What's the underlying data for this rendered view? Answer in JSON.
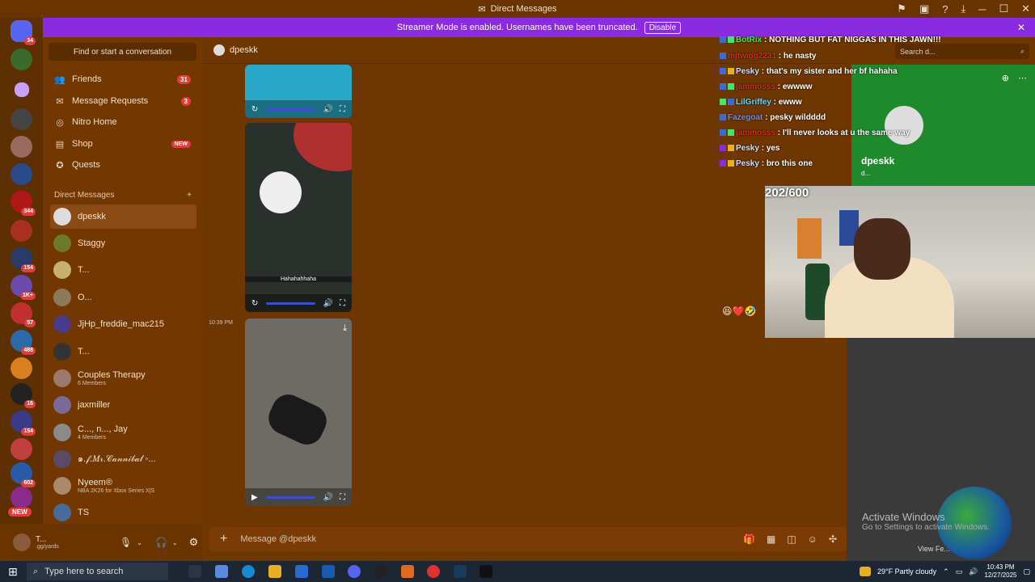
{
  "window": {
    "title": "Direct Messages"
  },
  "banner": {
    "text": "Streamer Mode is enabled. Usernames have been truncated.",
    "disable_label": "Disable"
  },
  "sidebar": {
    "search_label": "Find or start a conversation",
    "nav": [
      {
        "label": "Friends",
        "icon": "friends-icon",
        "count": "31"
      },
      {
        "label": "Message Requests",
        "icon": "mail-icon",
        "count": "3"
      },
      {
        "label": "Nitro Home",
        "icon": "nitro-icon"
      },
      {
        "label": "Shop",
        "icon": "shop-icon",
        "badge": "NEW"
      },
      {
        "label": "Quests",
        "icon": "quests-icon"
      }
    ],
    "dm_header": "Direct Messages",
    "dms": [
      {
        "name": "dpeskk"
      },
      {
        "name": "Staggy"
      },
      {
        "name": "T..."
      },
      {
        "name": "O..."
      },
      {
        "name": "JjHp_freddie_mac215"
      },
      {
        "name": "T..."
      },
      {
        "name": "Couples Therapy",
        "sub": "6 Members"
      },
      {
        "name": "jaxmiller"
      },
      {
        "name": "C..., n..., Jay",
        "sub": "4 Members"
      },
      {
        "name": "๑.𝒻.𝑀𝓇.𝒞𝒶𝓃𝓃𝒾𝒷𝒶𝓁 ◦..."
      },
      {
        "name": "Nyeem®",
        "sub": "NBA 2K26 for Xbox Series X|S"
      },
      {
        "name": "TS"
      }
    ]
  },
  "server_badges": [
    "34",
    "",
    "",
    "",
    "",
    "",
    "",
    "",
    "",
    "",
    "344",
    "154",
    "1K+",
    "",
    "57",
    "",
    "488",
    "",
    "",
    "16",
    "154",
    "",
    "602",
    "",
    "NEW"
  ],
  "user": {
    "name": "T...",
    "status": ".gg/yards"
  },
  "chat": {
    "recipient": "dpeskk",
    "timestamp": "10:39 PM",
    "caption": "Hahahahhaha",
    "placeholder": "Message @dpeskk"
  },
  "search": {
    "placeholder": "Search d..."
  },
  "overlay_chat": [
    {
      "user": "BotRix",
      "text": "NOTHING BUT FAT NIGGAS IN THIS JAWN!!!",
      "color": "#3ee86a"
    },
    {
      "user": "mjtwigg2231",
      "text": "he nasty",
      "color": "#d0301c"
    },
    {
      "user": "Pesky",
      "text": "that's my sister and her bf hahaha",
      "color": "#ffffff"
    },
    {
      "user": "jammosss",
      "text": "ewwww",
      "color": "#d0301c"
    },
    {
      "user": "LilGriffey",
      "text": "ewww",
      "color": "#5fd6ff"
    },
    {
      "user": "Fazegoat",
      "text": "pesky wildddd",
      "color": "#6a8cff"
    },
    {
      "user": "jammosss",
      "text": "I'll never looks at u the same way",
      "color": "#d0301c"
    },
    {
      "user": "Pesky",
      "text": "yes",
      "color": "#ffffff"
    },
    {
      "user": "Pesky",
      "text": "bro this one",
      "color": "#ffffff"
    }
  ],
  "profile": {
    "name": "dpeskk",
    "sub": "d..."
  },
  "stream": {
    "counter": "202/600"
  },
  "watermark": {
    "title": "Activate Windows",
    "sub": "Go to Settings to activate Windows.",
    "view": "View Fe..."
  },
  "taskbar": {
    "search_placeholder": "Type here to search",
    "weather": "29°F  Partly cloudy",
    "time": "10:43 PM",
    "date": "12/27/2025"
  }
}
